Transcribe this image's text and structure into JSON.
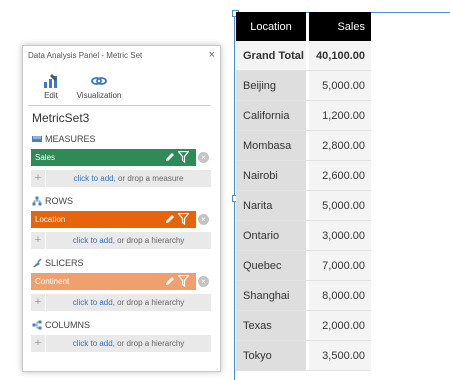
{
  "panel": {
    "title": "Data Analysis Panel - Metric Set",
    "close": "×",
    "toolbar": {
      "edit_label": "Edit",
      "visualization_label": "Visualization"
    },
    "metric_set_name": "MetricSet3",
    "sections": {
      "measures": {
        "label": "MEASURES",
        "chip": "Sales",
        "chip_color": "#2e8b57",
        "drop_link": "click to add",
        "drop_rest": ", or drop a measure"
      },
      "rows": {
        "label": "ROWS",
        "chip": "Location",
        "chip_color": "#e8640c",
        "drop_link": "click to add",
        "drop_rest": ", or drop a hierarchy"
      },
      "slicers": {
        "label": "SLICERS",
        "chip": "Continent",
        "chip_color": "#f0a06e",
        "drop_link": "click to add",
        "drop_rest": ", or drop a hierarchy"
      },
      "columns": {
        "label": "COLUMNS",
        "drop_link": "click to add",
        "drop_rest": ", or drop a hierarchy"
      }
    }
  },
  "table": {
    "headers": {
      "location": "Location",
      "sales": "Sales"
    },
    "total": {
      "label": "Grand Total",
      "value": "40,100.00"
    },
    "rows": [
      {
        "location": "Beijing",
        "sales": "5,000.00"
      },
      {
        "location": "California",
        "sales": "1,200.00"
      },
      {
        "location": "Mombasa",
        "sales": "2,800.00"
      },
      {
        "location": "Nairobi",
        "sales": "2,600.00"
      },
      {
        "location": "Narita",
        "sales": "5,000.00"
      },
      {
        "location": "Ontario",
        "sales": "3,000.00"
      },
      {
        "location": "Quebec",
        "sales": "7,000.00"
      },
      {
        "location": "Shanghai",
        "sales": "8,000.00"
      },
      {
        "location": "Texas",
        "sales": "2,000.00"
      },
      {
        "location": "Tokyo",
        "sales": "3,500.00"
      }
    ]
  }
}
